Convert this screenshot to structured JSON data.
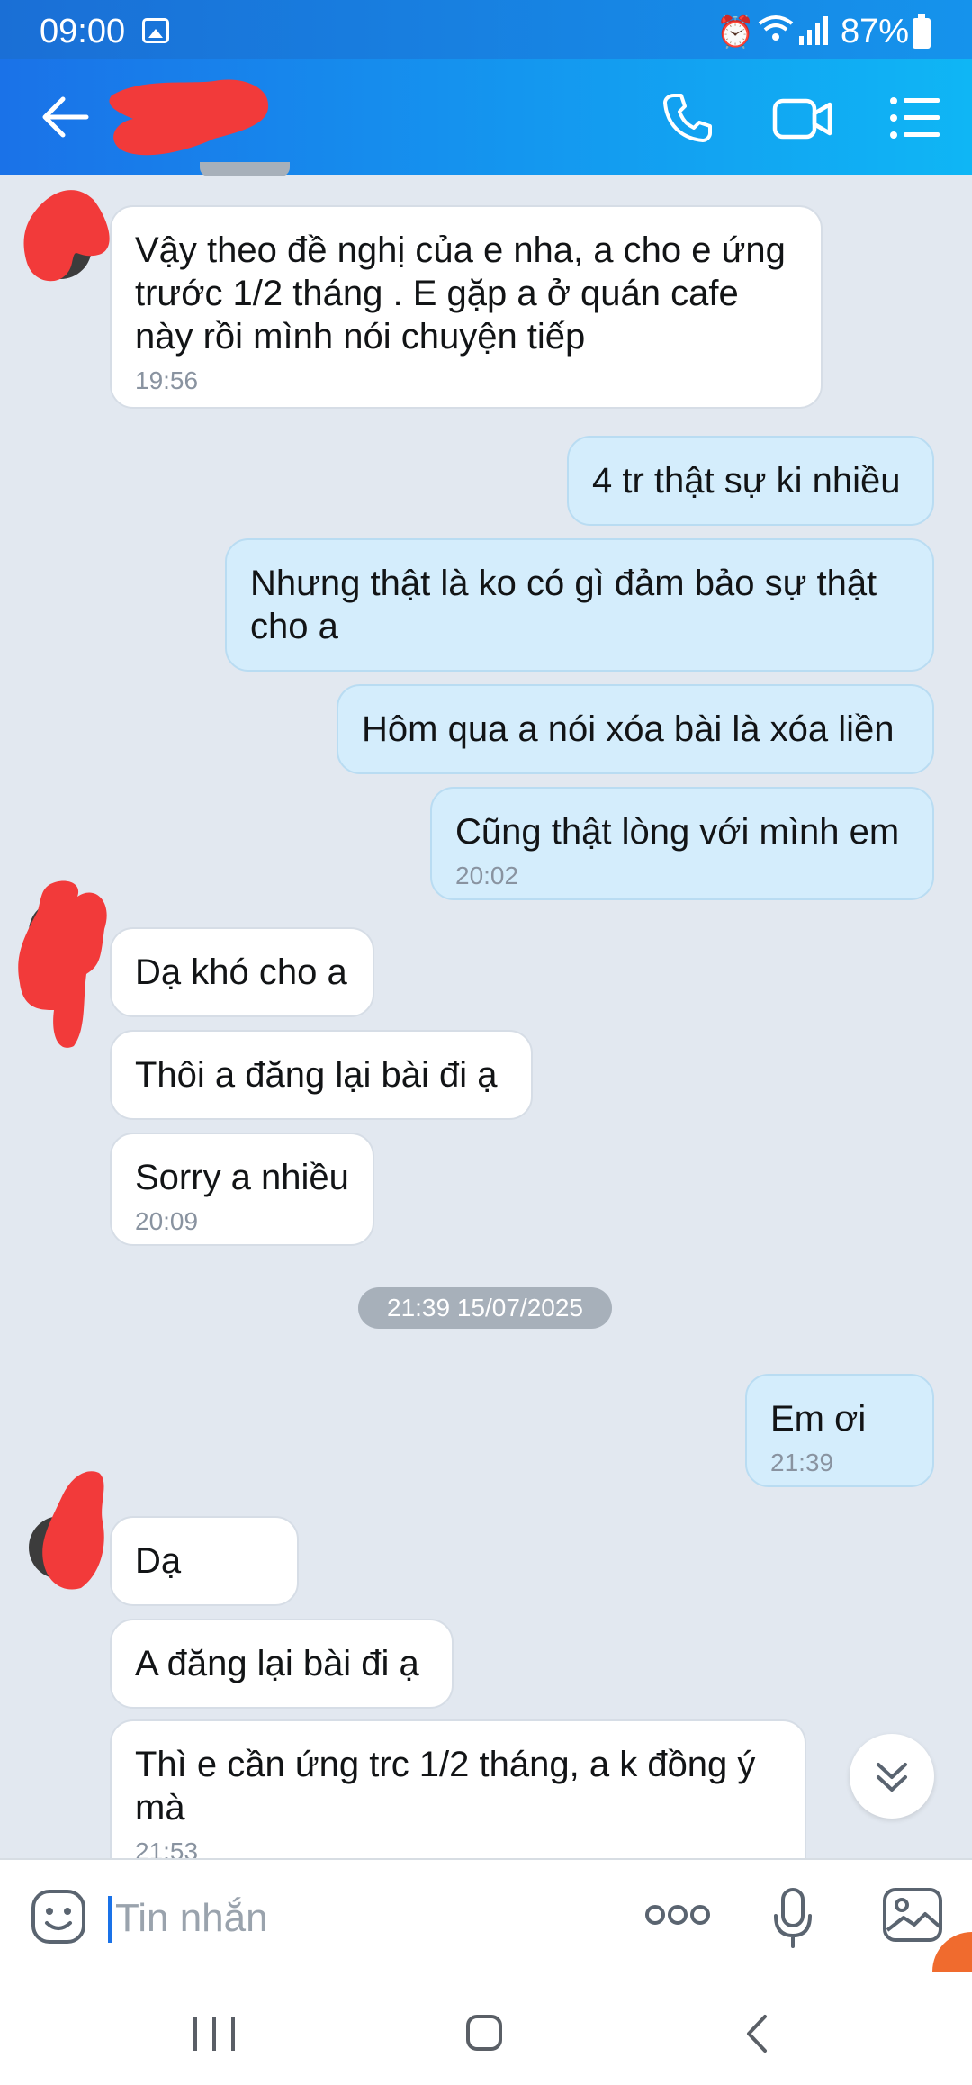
{
  "status_bar": {
    "time": "09:00",
    "battery": "87%"
  },
  "header": {
    "contact_name": "",
    "colors": {
      "gradient_start": "#1a72e8",
      "gradient_end": "#0fb6f5"
    }
  },
  "messages": [
    {
      "direction": "in",
      "text": "Vậy theo đề nghị của e nha, a cho e ứng trước 1/2 tháng . E gặp a ở quán cafe này rồi mình nói chuyện tiếp",
      "time": "19:56"
    },
    {
      "direction": "out",
      "text": "4 tr thật sự ki nhiều"
    },
    {
      "direction": "out",
      "text": "Nhưng thật là ko có gì đảm bảo sự thật cho a"
    },
    {
      "direction": "out",
      "text": "Hôm qua a nói xóa bài là xóa liền"
    },
    {
      "direction": "out",
      "text": "Cũng thật lòng với mình em",
      "time": "20:02"
    },
    {
      "direction": "in",
      "text": "Dạ khó cho a"
    },
    {
      "direction": "in",
      "text": "Thôi a đăng lại bài đi ạ"
    },
    {
      "direction": "in",
      "text": "Sorry a nhiều",
      "time": "20:09"
    },
    {
      "direction": "out",
      "text": "Em ơi",
      "time": "21:39"
    },
    {
      "direction": "in",
      "text": "Dạ"
    },
    {
      "direction": "in",
      "text": "A đăng lại bài đi ạ"
    },
    {
      "direction": "in",
      "text": "Thì e cần ứng trc 1/2 tháng, a k đồng ý mà",
      "time": "21:53"
    }
  ],
  "date_separator": "21:39 15/07/2025",
  "composer": {
    "placeholder": "Tin nhắn",
    "value": ""
  },
  "colors": {
    "chat_background": "#e2e8f0",
    "incoming_bubble": "#ffffff",
    "outgoing_bubble": "#d4edfc",
    "accent": "#1a72e8",
    "redaction": "#f23a3a"
  },
  "icons": {
    "header": [
      "back-arrow-icon",
      "phone-call-icon",
      "video-call-icon",
      "list-menu-icon"
    ],
    "composer": [
      "emoji-sticker-icon",
      "more-dots-icon",
      "microphone-icon",
      "image-gallery-icon"
    ],
    "navigation": [
      "recent-apps-icon",
      "home-icon",
      "back-nav-icon"
    ]
  }
}
